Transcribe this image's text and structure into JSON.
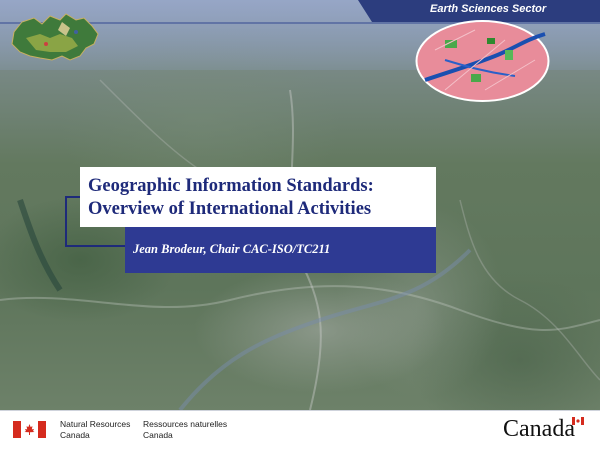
{
  "header": {
    "sector_label": "Earth Sciences Sector"
  },
  "slide": {
    "title_line1": "Geographic Information Standards:",
    "title_line2": "Overview of International Activities",
    "presenter": "Jean Brodeur, Chair CAC-ISO/TC211"
  },
  "footer": {
    "dept_en_line1": "Natural Resources",
    "dept_en_line2": "Canada",
    "dept_fr_line1": "Ressources naturelles",
    "dept_fr_line2": "Canada",
    "wordmark": "Canada"
  },
  "colors": {
    "title_text": "#1e2a7a",
    "subtitle_band": "#2e3a93",
    "header_band": "#2c3d7e",
    "flag_red": "#d52b1e"
  },
  "icons": [
    "canada-map-icon",
    "city-map-icon",
    "canada-flag-icon",
    "wordmark-flag-icon"
  ]
}
